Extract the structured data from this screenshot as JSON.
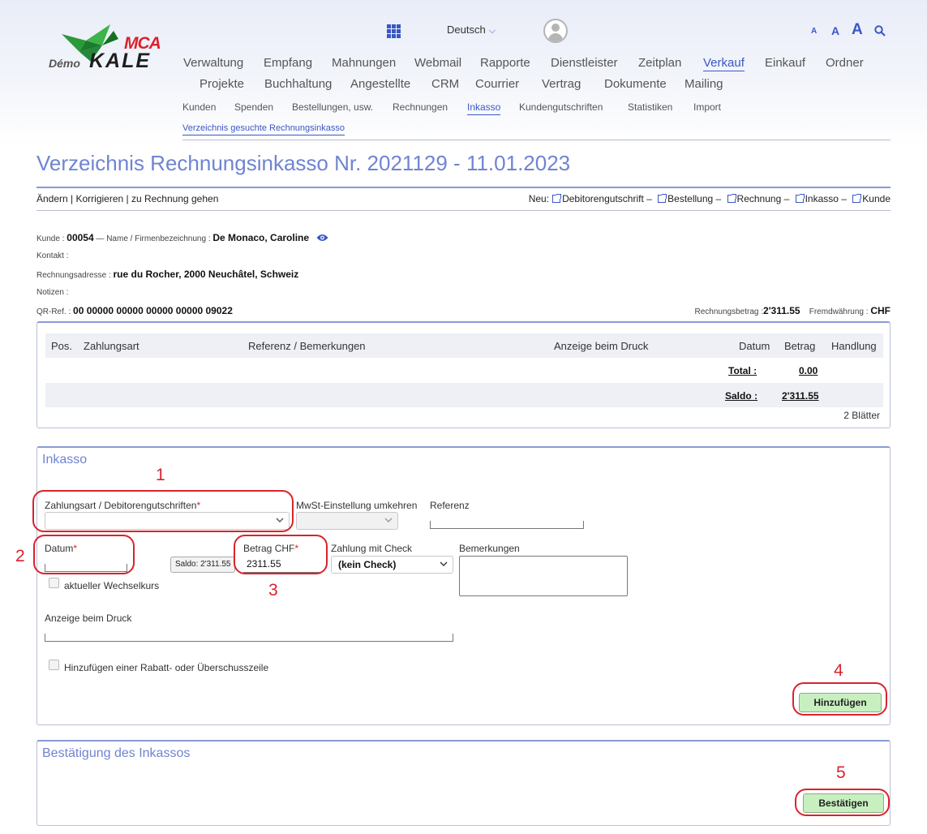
{
  "top": {
    "language": "Deutsch",
    "font_sizes": [
      "A",
      "A",
      "A"
    ],
    "logo": {
      "brand_top": "MCA",
      "brand_main": "KALE",
      "prefix": "Démo"
    }
  },
  "nav": {
    "row1": [
      "Verwaltung",
      "Empfang",
      "Mahnungen",
      "Webmail",
      "Rapporte",
      "Dienstleister",
      "Zeitplan",
      "Verkauf",
      "Einkauf",
      "Ordner"
    ],
    "row2": [
      "Projekte",
      "Buchhaltung",
      "Angestellte",
      "CRM",
      "Courrier",
      "Vertrag",
      "Dokumente",
      "Mailing"
    ],
    "sub": [
      "Kunden",
      "Spenden",
      "Bestellungen, usw.",
      "Rechnungen",
      "Inkasso",
      "Kundengutschriften",
      "Statistiken",
      "Import"
    ],
    "subsub": "Verzeichnis gesuchte Rechnungsinkasso"
  },
  "page": {
    "title": "Verzeichnis Rechnungsinkasso Nr. 2021129 - 11.01.2023",
    "actions": "Ändern | Korrigieren | zu Rechnung gehen",
    "new_prefix": "Neu:",
    "new_items": [
      "Debitorengutschrift",
      "Bestellung",
      "Rechnung",
      "Inkasso",
      "Kunde"
    ]
  },
  "info": {
    "kunde_label": "Kunde :",
    "kunde_value": "00054",
    "name_label": "— Name / Firmenbezeichnung :",
    "name_value": "De Monaco, Caroline",
    "kontakt_label": "Kontakt :",
    "adresse_label": "Rechnungsadresse :",
    "adresse_value": "rue du Rocher, 2000 Neuchâtel, Schweiz",
    "notizen_label": "Notizen :",
    "qr_label": "QR-Ref. :",
    "qr_value": "00 00000 00000 00000 00000 09022",
    "betrag_label": "Rechnungsbetrag :",
    "betrag_value": "2'311.55",
    "waehrung_label": "Fremdwährung :",
    "waehrung_value": "CHF"
  },
  "table": {
    "headers": [
      "Pos.",
      "Zahlungsart",
      "Referenz / Bemerkungen",
      "Anzeige beim Druck",
      "Datum",
      "Betrag",
      "Handlung"
    ],
    "total_label": "Total :",
    "total_value": "0.00",
    "saldo_label": "Saldo :",
    "saldo_value": "2'311.55",
    "pages": "2 Blätter"
  },
  "inkasso": {
    "title": "Inkasso",
    "zahlungsart_label": "Zahlungsart / Debitorengutschriften",
    "mwst_label": "MwSt-Einstellung umkehren",
    "referenz_label": "Referenz",
    "datum_label": "Datum",
    "saldo_button": "Saldo: 2'311.55",
    "betrag_label": "Betrag CHF",
    "betrag_value": "2311.55",
    "check_label": "Zahlung mit Check",
    "check_value": "(kein Check)",
    "bemerkungen_label": "Bemerkungen",
    "wechselkurs_label": "aktueller Wechselkurs",
    "anzeige_label": "Anzeige beim Druck",
    "rabatt_label": "Hinzufügen einer Rabatt- oder Überschusszeile",
    "add_button": "Hinzufügen"
  },
  "confirm": {
    "title": "Bestätigung des Inkassos",
    "button": "Bestätigen"
  },
  "annotations": [
    "1",
    "2",
    "3",
    "4",
    "5"
  ],
  "colors": {
    "accent": "#3a57c4",
    "title": "#6f84d2",
    "annotation": "#d9232d",
    "button_green": "#c8efc0"
  }
}
